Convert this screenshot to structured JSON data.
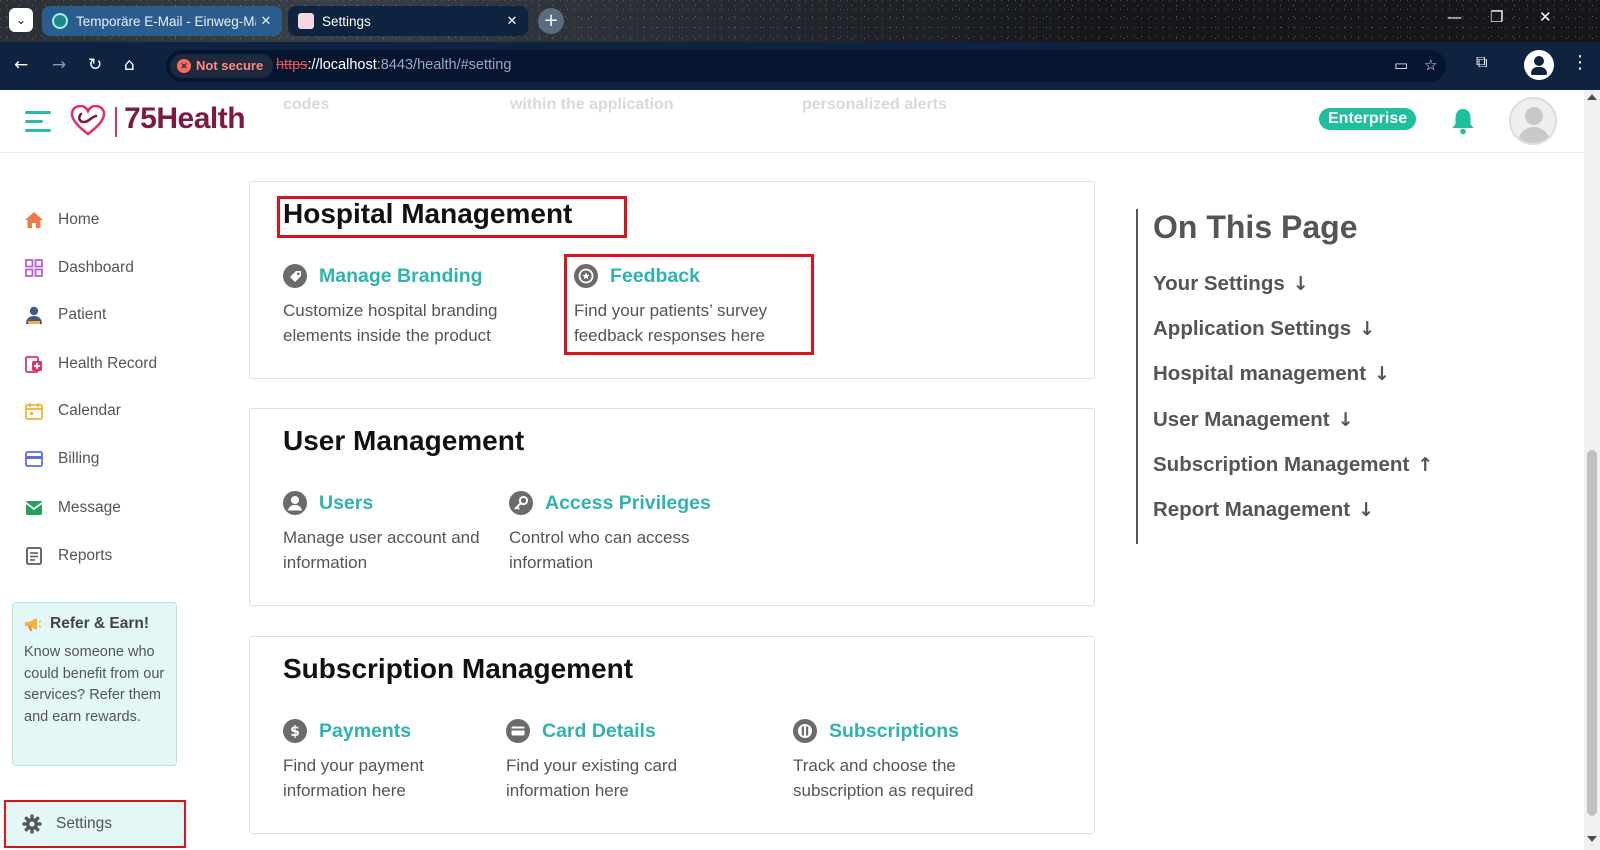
{
  "browser": {
    "tabs": [
      {
        "title": "Temporäre E-Mail - Einweg-Ma",
        "active": false
      },
      {
        "title": "Settings",
        "active": true
      }
    ],
    "security_label": "Not secure",
    "url_scheme": "https",
    "url_host": "://localhost",
    "url_rest": ":8443/health/#setting",
    "win_min": "—",
    "win_restore": "❐",
    "win_close": "✕"
  },
  "header": {
    "ghost_texts": [
      "codes",
      "within the application",
      "personalized alerts"
    ],
    "brand": "75Health",
    "plan_badge": "Enterprise"
  },
  "sidebar": {
    "items": [
      {
        "label": "Home",
        "icon": "home-icon",
        "color": "#f2794a"
      },
      {
        "label": "Dashboard",
        "icon": "dashboard-icon",
        "color": "#b65fd6"
      },
      {
        "label": "Patient",
        "icon": "patient-icon",
        "color": "#3f5a8a"
      },
      {
        "label": "Health Record",
        "icon": "health-record-icon",
        "color": "#e0336b"
      },
      {
        "label": "Calendar",
        "icon": "calendar-icon",
        "color": "#f2b13d"
      },
      {
        "label": "Billing",
        "icon": "billing-icon",
        "color": "#5b6ee0"
      },
      {
        "label": "Message",
        "icon": "message-icon",
        "color": "#23a35a"
      },
      {
        "label": "Reports",
        "icon": "reports-icon",
        "color": "#5a5a5a"
      }
    ],
    "refer": {
      "title": "Refer & Earn!",
      "text": "Know someone who could benefit from our services? Refer them and earn rewards."
    },
    "settings_label": "Settings"
  },
  "sections": {
    "hospital": {
      "title": "Hospital Management",
      "items": [
        {
          "label": "Manage Branding",
          "desc": "Customize hospital branding elements inside the product",
          "icon": "tag-icon"
        },
        {
          "label": "Feedback",
          "desc": "Find your patients’ survey feedback responses here",
          "icon": "feedback-icon"
        }
      ]
    },
    "user": {
      "title": "User Management",
      "items": [
        {
          "label": "Users",
          "desc": "Manage user account and information",
          "icon": "user-icon"
        },
        {
          "label": "Access Privileges",
          "desc": "Control who can access information",
          "icon": "key-icon"
        }
      ]
    },
    "subscription": {
      "title": "Subscription Management",
      "items": [
        {
          "label": "Payments",
          "desc": "Find your payment information here",
          "icon": "dollar-icon"
        },
        {
          "label": "Card Details",
          "desc": "Find your existing card information here",
          "icon": "card-icon"
        },
        {
          "label": "Subscriptions",
          "desc": "Track and choose the subscription as required",
          "icon": "subscription-icon"
        }
      ]
    }
  },
  "on_this_page": {
    "title": "On This Page",
    "links": [
      {
        "label": "Your Settings",
        "arrow": "↓"
      },
      {
        "label": "Application Settings",
        "arrow": "↓"
      },
      {
        "label": "Hospital management",
        "arrow": "↓"
      },
      {
        "label": "User Management",
        "arrow": "↓"
      },
      {
        "label": "Subscription Management",
        "arrow": "↑"
      },
      {
        "label": "Report Management",
        "arrow": "↓"
      }
    ]
  },
  "colors": {
    "accent": "#2fb4ad",
    "highlight": "#d9141b",
    "brand": "#7b1b45"
  }
}
